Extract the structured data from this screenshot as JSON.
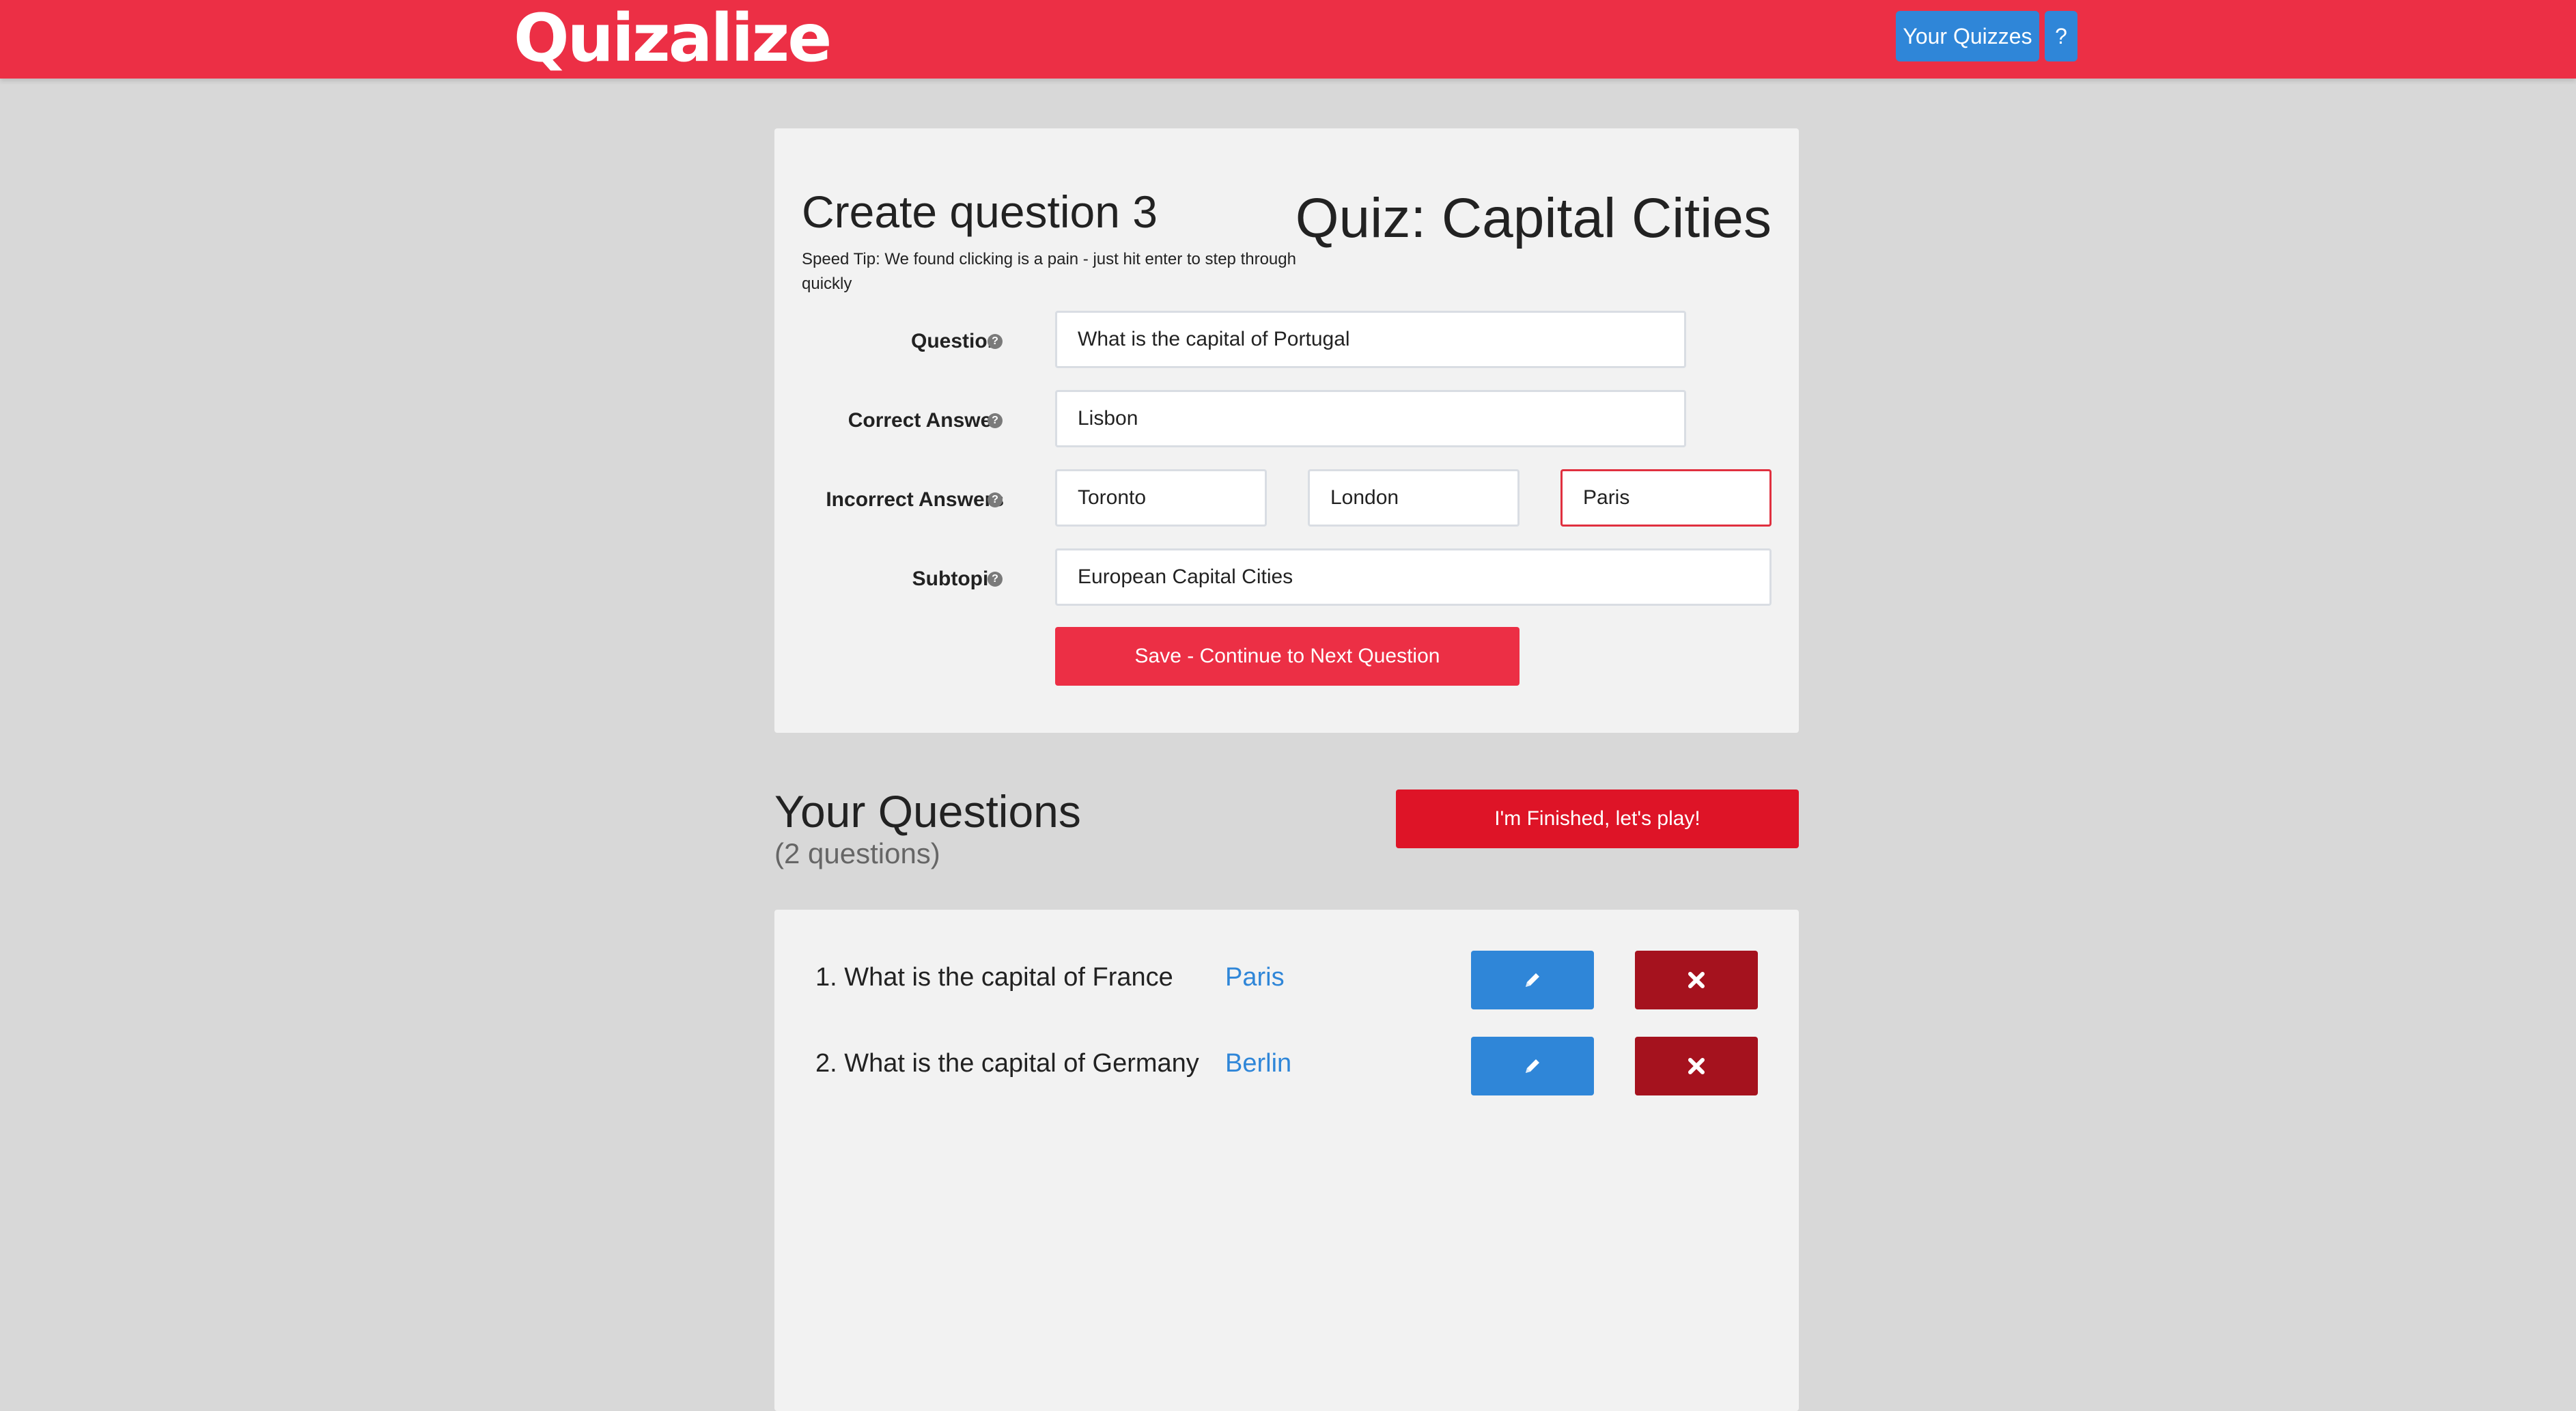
{
  "header": {
    "logo_text": "Quizalize",
    "nav": {
      "your_quizzes": "Your Quizzes",
      "help": "?"
    }
  },
  "create_form": {
    "title": "Create question 3",
    "quiz_title": "Quiz: Capital Cities",
    "speed_tip": "Speed Tip: We found clicking is a pain - just hit enter to step through quickly",
    "labels": {
      "question": "Question",
      "correct_answer": "Correct Answer",
      "incorrect_answers": "Incorrect Answers",
      "subtopic": "Subtopic"
    },
    "help_icon": "?",
    "values": {
      "question": "What is the capital of Portugal",
      "correct_answer": "Lisbon",
      "incorrect_1": "Toronto",
      "incorrect_2": "London",
      "incorrect_3": "Paris",
      "subtopic": "European Capital Cities"
    },
    "save_label": "Save - Continue to Next Question"
  },
  "questions_section": {
    "title": "Your Questions",
    "count": "(2 questions)",
    "finish_label": "I'm Finished, let's play!",
    "items": [
      {
        "text": "1. What is the capital of France",
        "answer": "Paris",
        "edit_icon": "pencil-icon",
        "delete_icon": "close-icon"
      },
      {
        "text": "2. What is the capital of Germany",
        "answer": "Berlin",
        "edit_icon": "pencil-icon",
        "delete_icon": "close-icon"
      }
    ]
  },
  "colors": {
    "brand_red": "#ec2f45",
    "finish_red": "#de1427",
    "delete_red": "#a5121e",
    "accent_blue": "#2f86d8",
    "page_bg": "#d8d8d8",
    "card_bg": "#f2f2f2"
  }
}
